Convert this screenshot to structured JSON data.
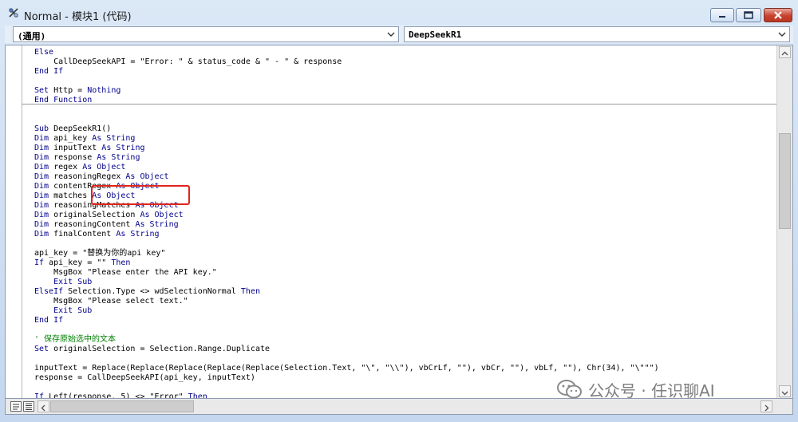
{
  "window": {
    "title": "Normal - 模块1 (代码)",
    "min_glyph": "minimize-icon",
    "max_glyph": "maximize-icon",
    "close_glyph": "close-icon"
  },
  "combos": {
    "object": "(通用)",
    "procedure": "DeepSeekR1"
  },
  "code_lines": [
    {
      "parts": [
        {
          "t": "kw",
          "v": "Else"
        }
      ]
    },
    {
      "parts": [
        {
          "t": "",
          "v": "    CallDeepSeekAPI = \"Error: \" & status_code & \" - \" & response"
        }
      ]
    },
    {
      "parts": [
        {
          "t": "kw",
          "v": "End If"
        }
      ]
    },
    {
      "parts": [
        {
          "t": "",
          "v": ""
        }
      ]
    },
    {
      "parts": [
        {
          "t": "kw",
          "v": "Set"
        },
        {
          "t": "",
          "v": " Http = "
        },
        {
          "t": "kw",
          "v": "Nothing"
        }
      ]
    },
    {
      "parts": [
        {
          "t": "kw",
          "v": "End Function"
        }
      ]
    },
    {
      "parts": [
        {
          "t": "",
          "v": ""
        }
      ]
    },
    {
      "parts": [
        {
          "t": "",
          "v": ""
        }
      ]
    },
    {
      "parts": [
        {
          "t": "kw",
          "v": "Sub"
        },
        {
          "t": "",
          "v": " DeepSeekR1()"
        }
      ]
    },
    {
      "parts": [
        {
          "t": "kw",
          "v": "Dim"
        },
        {
          "t": "",
          "v": " api_key "
        },
        {
          "t": "kw",
          "v": "As String"
        }
      ]
    },
    {
      "parts": [
        {
          "t": "kw",
          "v": "Dim"
        },
        {
          "t": "",
          "v": " inputText "
        },
        {
          "t": "kw",
          "v": "As String"
        }
      ]
    },
    {
      "parts": [
        {
          "t": "kw",
          "v": "Dim"
        },
        {
          "t": "",
          "v": " response "
        },
        {
          "t": "kw",
          "v": "As String"
        }
      ]
    },
    {
      "parts": [
        {
          "t": "kw",
          "v": "Dim"
        },
        {
          "t": "",
          "v": " regex "
        },
        {
          "t": "kw",
          "v": "As Object"
        }
      ]
    },
    {
      "parts": [
        {
          "t": "kw",
          "v": "Dim"
        },
        {
          "t": "",
          "v": " reasoningRegex "
        },
        {
          "t": "kw",
          "v": "As Object"
        }
      ]
    },
    {
      "parts": [
        {
          "t": "kw",
          "v": "Dim"
        },
        {
          "t": "",
          "v": " contentRegex "
        },
        {
          "t": "kw",
          "v": "As Object"
        }
      ]
    },
    {
      "parts": [
        {
          "t": "kw",
          "v": "Dim"
        },
        {
          "t": "",
          "v": " matches "
        },
        {
          "t": "kw",
          "v": "As Object"
        }
      ]
    },
    {
      "parts": [
        {
          "t": "kw",
          "v": "Dim"
        },
        {
          "t": "",
          "v": " reasoningMatches "
        },
        {
          "t": "kw",
          "v": "As Object"
        }
      ]
    },
    {
      "parts": [
        {
          "t": "kw",
          "v": "Dim"
        },
        {
          "t": "",
          "v": " originalSelection "
        },
        {
          "t": "kw",
          "v": "As Object"
        }
      ]
    },
    {
      "parts": [
        {
          "t": "kw",
          "v": "Dim"
        },
        {
          "t": "",
          "v": " reasoningContent "
        },
        {
          "t": "kw",
          "v": "As String"
        }
      ]
    },
    {
      "parts": [
        {
          "t": "kw",
          "v": "Dim"
        },
        {
          "t": "",
          "v": " finalContent "
        },
        {
          "t": "kw",
          "v": "As String"
        }
      ]
    },
    {
      "parts": [
        {
          "t": "",
          "v": ""
        }
      ]
    },
    {
      "parts": [
        {
          "t": "",
          "v": "api_key = \"替换为你的api key\""
        }
      ]
    },
    {
      "parts": [
        {
          "t": "kw",
          "v": "If"
        },
        {
          "t": "",
          "v": " api_key = \"\" "
        },
        {
          "t": "kw",
          "v": "Then"
        }
      ]
    },
    {
      "parts": [
        {
          "t": "",
          "v": "    MsgBox \"Please enter the API key.\""
        }
      ]
    },
    {
      "parts": [
        {
          "t": "kw",
          "v": "    Exit Sub"
        }
      ]
    },
    {
      "parts": [
        {
          "t": "kw",
          "v": "ElseIf"
        },
        {
          "t": "",
          "v": " Selection.Type <> wdSelectionNormal "
        },
        {
          "t": "kw",
          "v": "Then"
        }
      ]
    },
    {
      "parts": [
        {
          "t": "",
          "v": "    MsgBox \"Please select text.\""
        }
      ]
    },
    {
      "parts": [
        {
          "t": "kw",
          "v": "    Exit Sub"
        }
      ]
    },
    {
      "parts": [
        {
          "t": "kw",
          "v": "End If"
        }
      ]
    },
    {
      "parts": [
        {
          "t": "",
          "v": ""
        }
      ]
    },
    {
      "parts": [
        {
          "t": "cm",
          "v": "' 保存原始选中的文本"
        }
      ]
    },
    {
      "parts": [
        {
          "t": "kw",
          "v": "Set"
        },
        {
          "t": "",
          "v": " originalSelection = Selection.Range.Duplicate"
        }
      ]
    },
    {
      "parts": [
        {
          "t": "",
          "v": ""
        }
      ]
    },
    {
      "parts": [
        {
          "t": "",
          "v": "inputText = Replace(Replace(Replace(Replace(Replace(Selection.Text, \"\\\", \"\\\\\"), vbCrLf, \"\"), vbCr, \"\"), vbLf, \"\"), Chr(34), \"\\\"\"\")"
        }
      ]
    },
    {
      "parts": [
        {
          "t": "",
          "v": "response = CallDeepSeekAPI(api_key, inputText)"
        }
      ]
    },
    {
      "parts": [
        {
          "t": "",
          "v": ""
        }
      ]
    },
    {
      "parts": [
        {
          "t": "kw",
          "v": "If"
        },
        {
          "t": "",
          "v": " Left(response, 5) <> \"Error\" "
        },
        {
          "t": "kw",
          "v": "Then"
        }
      ]
    }
  ],
  "watermark": {
    "text": "公众号 · 任识聊AI",
    "icon": "wechat-icon"
  }
}
